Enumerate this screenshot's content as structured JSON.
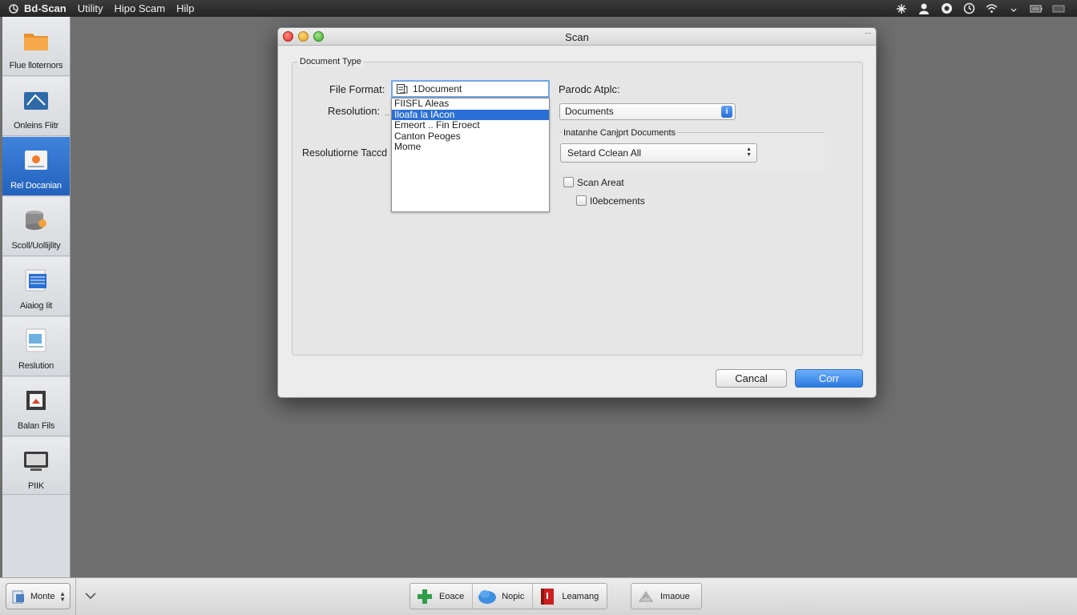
{
  "menubar": {
    "app_name": "Bd-Scan",
    "items": [
      "Utility",
      "Hipo Scam",
      "Hilp"
    ],
    "status_icons": [
      "network-icon",
      "user-icon",
      "sync-icon",
      "clock-icon",
      "wifi-icon",
      "battery-icon"
    ]
  },
  "sidebar": {
    "items": [
      {
        "label": "Flue lloternors",
        "icon": "folder-icon"
      },
      {
        "label": "Onleins Fiitr",
        "icon": "scanner-icon"
      },
      {
        "label": "Rel Docanian",
        "icon": "document-icon",
        "selected": true
      },
      {
        "label": "Scoll/Uollijlity",
        "icon": "disk-icon"
      },
      {
        "label": "Aiaiog Iit",
        "icon": "list-icon"
      },
      {
        "label": "Reslution",
        "icon": "page-icon"
      },
      {
        "label": "Balan Fils",
        "icon": "archive-icon"
      },
      {
        "label": "PIIK",
        "icon": "monitor-icon"
      }
    ]
  },
  "dialog": {
    "title": "Scan",
    "group_label": "Document Type",
    "file_format_label": "File Format:",
    "file_format_value": "1Document",
    "resolution_label": "Resolution:",
    "resolution_tacc_label": "Resolutiorne Taccd",
    "format_options": [
      "FIISFL Aleas",
      "Iloafa la lAcon",
      "Emeort .. Fin Eroect",
      "Canton Peoges",
      "Mome"
    ],
    "format_selected_index": 1,
    "parodc_label": "Parodc Atplc:",
    "documents_value": "Documents",
    "info_glyph": "i",
    "subgroup_label": "Inatanhe Canjprt Documents",
    "scan_select_value": "Setard Cclean All",
    "checkbox1_label": "Scan Areat",
    "checkbox2_label": "I0ebcements",
    "cancel_label": "Cancal",
    "ok_label": "Corr"
  },
  "bottombar": {
    "mode_label": "Monte",
    "tools": [
      {
        "label": "Eoace",
        "icon": "plus-icon"
      },
      {
        "label": "Nopic",
        "icon": "cloud-icon"
      },
      {
        "label": "Leamang",
        "icon": "book-icon"
      },
      {
        "label": "Imaoue",
        "icon": "image-icon"
      }
    ]
  },
  "colors": {
    "selection_blue": "#2a6fd6",
    "desktop_gray": "#6f6f6f",
    "menubar_dark": "#2d2d2d"
  }
}
